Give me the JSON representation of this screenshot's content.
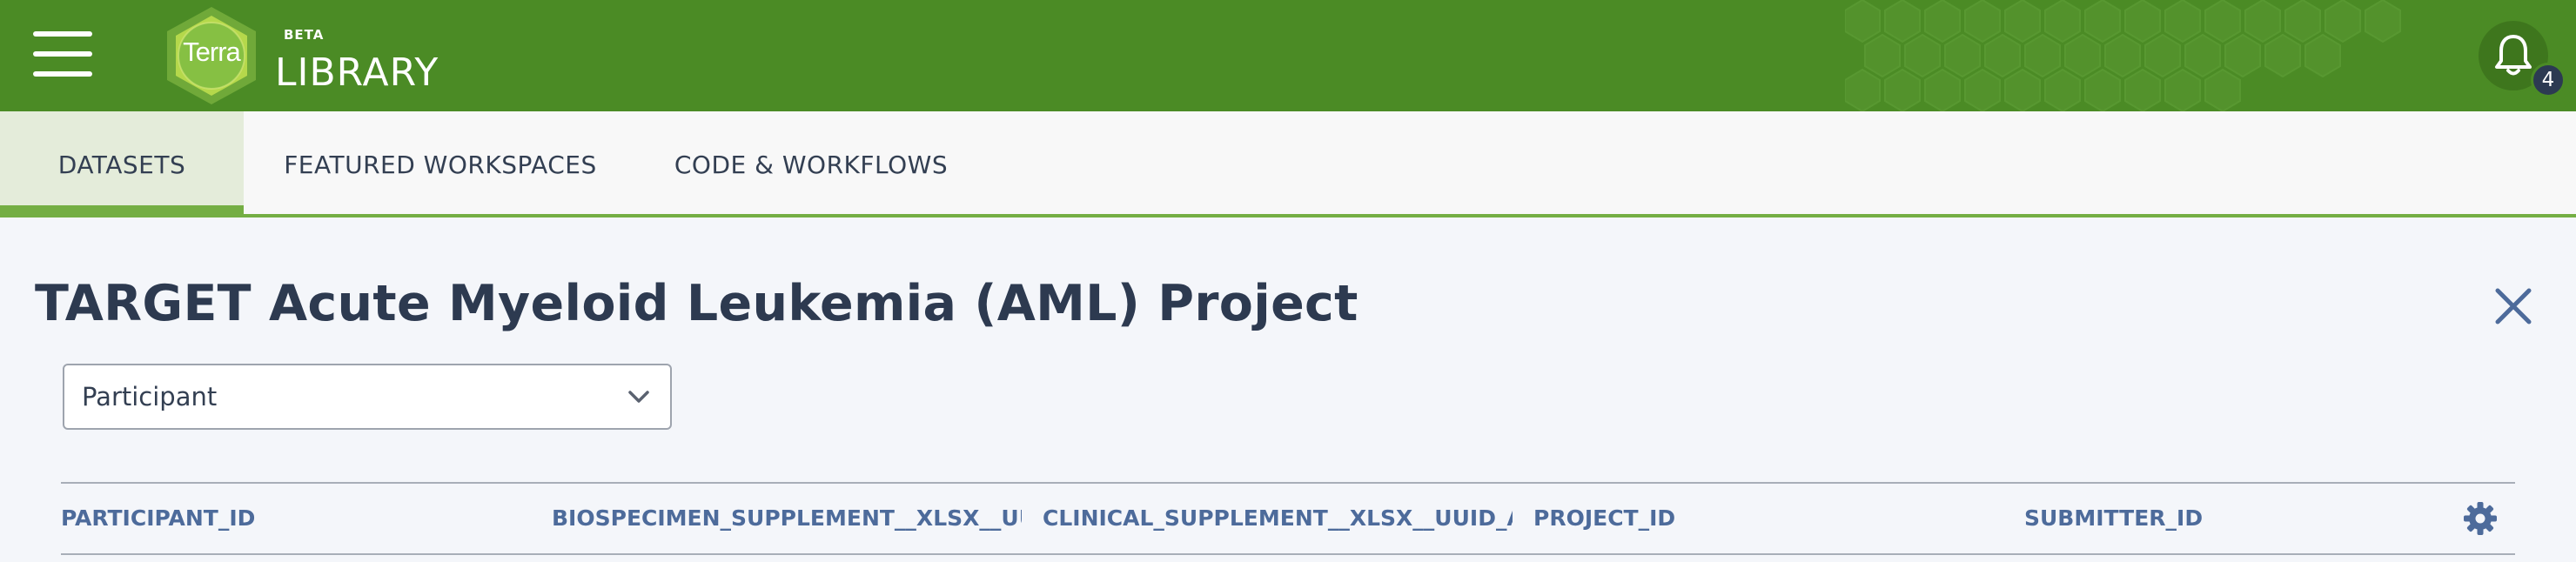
{
  "header": {
    "logo_text": "Terra",
    "badge": "BETA",
    "title": "LIBRARY",
    "notification_count": "4"
  },
  "tabs": [
    {
      "label": "DATASETS",
      "active": true
    },
    {
      "label": "FEATURED WORKSPACES",
      "active": false
    },
    {
      "label": "CODE & WORKFLOWS",
      "active": false
    }
  ],
  "page": {
    "title": "TARGET Acute Myeloid Leukemia (AML) Project"
  },
  "entity_select": {
    "value": "Participant"
  },
  "table": {
    "columns": [
      "PARTICIPANT_ID",
      "BIOSPECIMEN_SUPPLEMENT__XLSX__UUI",
      "CLINICAL_SUPPLEMENT__XLSX__UUID_AN",
      "PROJECT_ID",
      "SUBMITTER_ID"
    ]
  },
  "colors": {
    "header_green": "#4b8b25",
    "accent_green": "#74ae43",
    "title_text": "#2d3a50",
    "column_header": "#4d6b9b"
  },
  "icons": {
    "menu": "hamburger-menu-icon",
    "notifications": "bell-icon",
    "close": "close-icon",
    "dropdown": "chevron-down-icon",
    "settings": "gear-icon"
  }
}
